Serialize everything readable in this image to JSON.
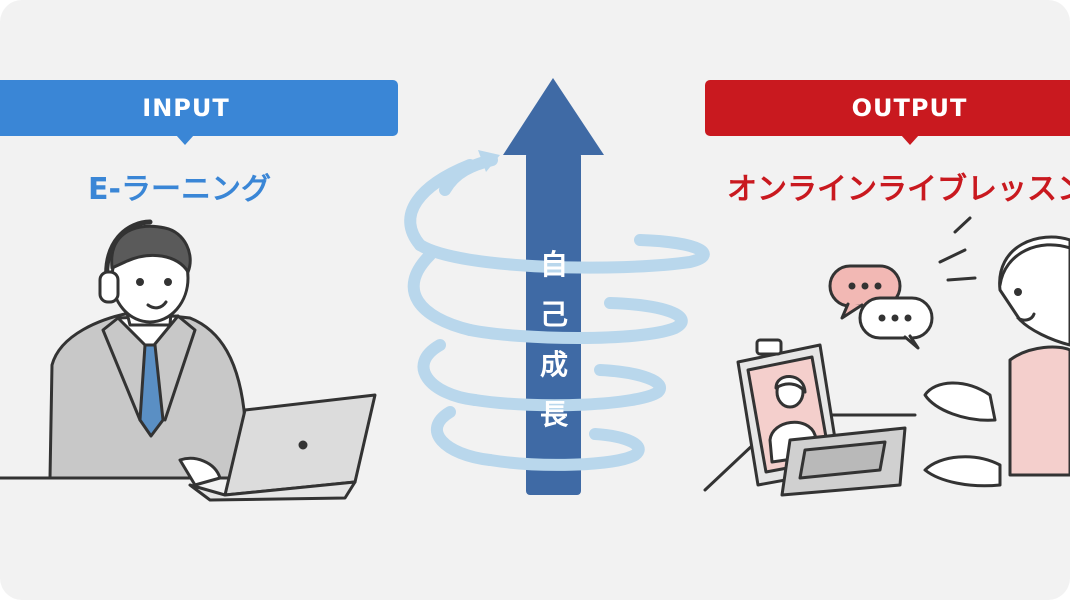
{
  "input": {
    "label": "INPUT",
    "title": "E-ラーニング"
  },
  "output": {
    "label": "OUTPUT",
    "title": "オンラインライブレッスン"
  },
  "center": {
    "chars": [
      "自",
      "己",
      "成",
      "長"
    ]
  },
  "colors": {
    "input": "#3a86d6",
    "output": "#c9191f",
    "arrow": "#3f6aa5",
    "spiral": "#b9d7ec",
    "background": "#f2f2f2"
  }
}
